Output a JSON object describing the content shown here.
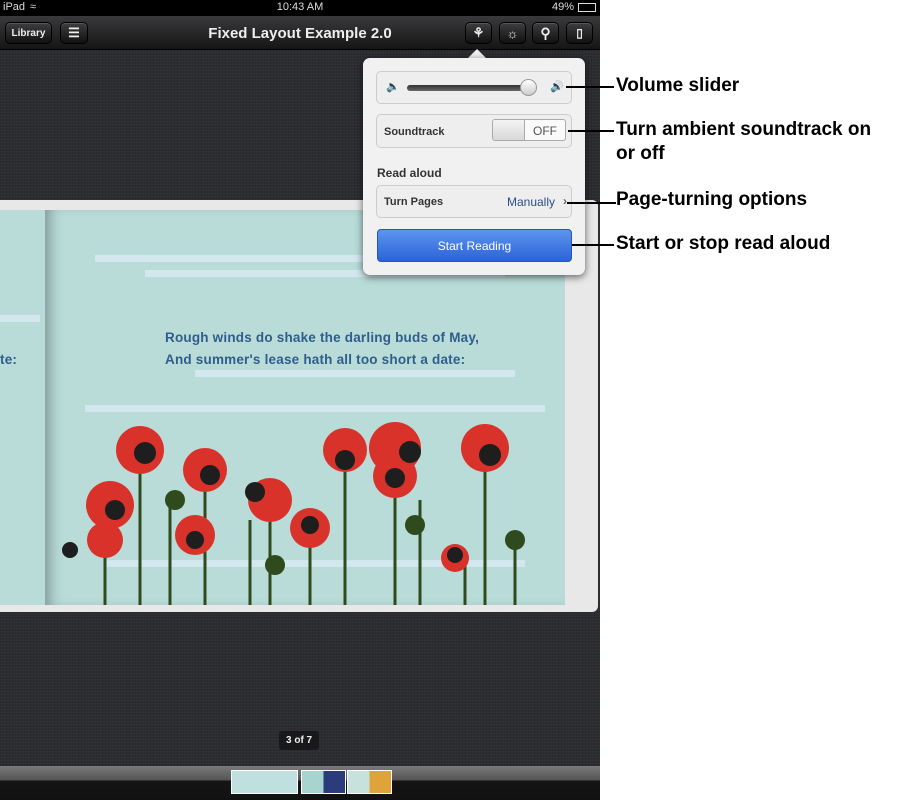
{
  "status": {
    "device": "iPad",
    "time": "10:43 AM",
    "battery": "49%"
  },
  "toolbar": {
    "library_label": "Library",
    "title": "Fixed Layout Example 2.0"
  },
  "page": {
    "lines": [
      "Rough winds do shake the darling buds of May,",
      "And summer's lease hath all too short a date:"
    ],
    "left_fragment": "te:"
  },
  "popover": {
    "volume_level": 0.93,
    "soundtrack_label": "Soundtrack",
    "soundtrack_state": "OFF",
    "read_aloud_heading": "Read aloud",
    "turn_pages_label": "Turn Pages",
    "turn_pages_value": "Manually",
    "start_label": "Start Reading"
  },
  "page_indicator": "3 of 7",
  "callouts": [
    "Volume slider",
    "Turn ambient soundtrack on or off",
    "Page-turning options",
    "Start or stop read aloud"
  ],
  "colors": {
    "accent": "#3a74e4",
    "poem": "#2f5d8c",
    "poppy": "#d8322a"
  }
}
